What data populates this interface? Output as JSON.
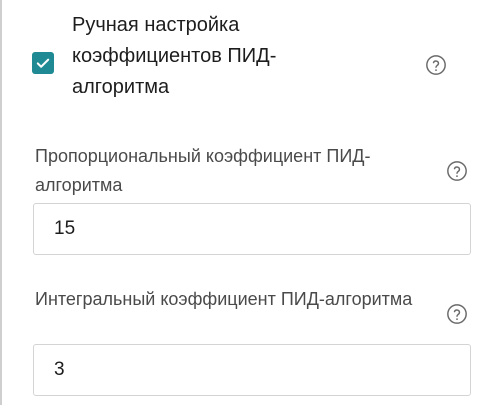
{
  "manual_pid": {
    "checked": true,
    "label": "Ручная настройка коэффициентов ПИД-алгоритма",
    "help_icon": "help-circle-icon"
  },
  "fields": [
    {
      "label": "Пропорциональный коэффициент ПИД-алгоритма",
      "value": "15",
      "help_icon": "help-circle-icon"
    },
    {
      "label": "Интегральный коэффициент ПИД-алгоритма",
      "value": "3",
      "help_icon": "help-circle-icon"
    }
  ],
  "colors": {
    "accent": "#1f8a94",
    "text": "#1d1d1d",
    "label": "#4a4a4a",
    "border": "#d4d4d4"
  }
}
